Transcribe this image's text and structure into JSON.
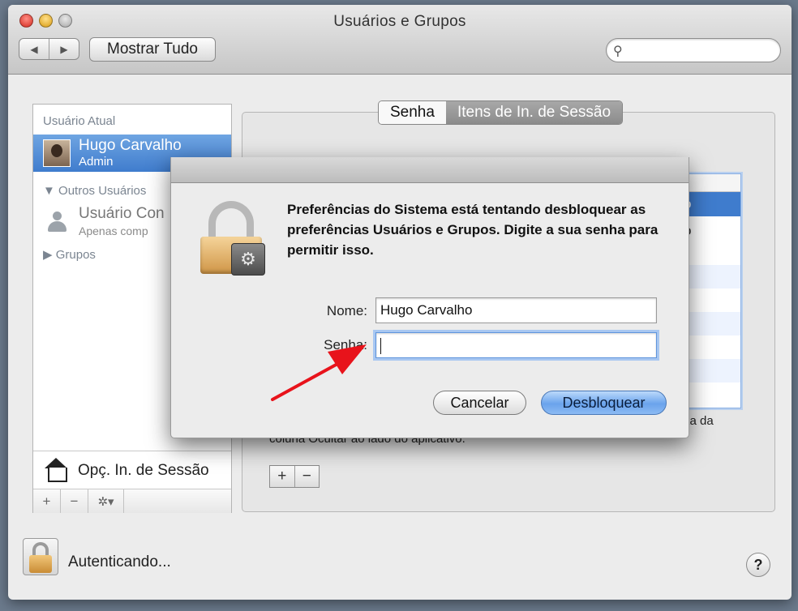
{
  "window": {
    "title": "Usuários e Grupos"
  },
  "toolbar": {
    "back_label": "◀",
    "forward_label": "▶",
    "show_all_label": "Mostrar Tudo",
    "search_placeholder": ""
  },
  "sidebar": {
    "current_header": "Usuário Atual",
    "current_user": {
      "name": "Hugo Carvalho",
      "role": "Admin"
    },
    "others_header": "Outros Usuários",
    "guest": {
      "name": "Usuário Con",
      "sub": "Apenas comp"
    },
    "groups_label": "Grupos",
    "login_options_label": "Opç. In. de Sessão",
    "tools": {
      "add": "+",
      "remove": "−",
      "gear": "✲▾"
    }
  },
  "panel": {
    "tabs": [
      {
        "label": "Senha",
        "active": true
      },
      {
        "label": "Itens de In. de Sessão",
        "active": false
      }
    ],
    "list_selected_fragment": "o",
    "list_row2_fragment": "o",
    "hint_line1_fragment": "xa da",
    "hint_line2": "coluna Ocultar ao lado do aplicativo.",
    "add": "+",
    "remove": "−"
  },
  "footer": {
    "status_text": "Autenticando...",
    "help_label": "?"
  },
  "dialog": {
    "message": "Preferências do Sistema está tentando desbloquear as preferências Usuários e Grupos. Digite a sua senha para permitir isso.",
    "name_label": "Nome:",
    "name_value": "Hugo Carvalho",
    "password_label": "Senha:",
    "password_value": "",
    "cancel_label": "Cancelar",
    "unlock_label": "Desbloquear"
  },
  "colors": {
    "selection": "#3f7ccd",
    "default_button": "#6aa3ec",
    "annotation_arrow": "#e8131b"
  }
}
